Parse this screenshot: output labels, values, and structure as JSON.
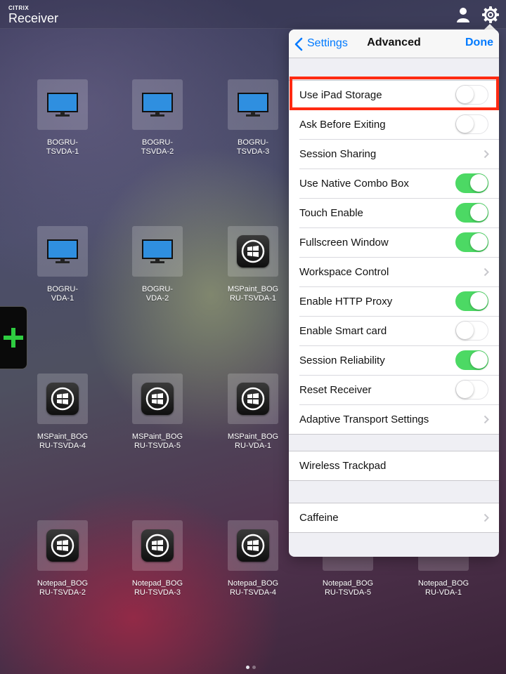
{
  "brand": {
    "small": "CITRIX",
    "large": "Receiver"
  },
  "topbar_icons": [
    "person-icon",
    "gear-icon"
  ],
  "tiles": [
    {
      "label": "BOGRU-\nTSVDA-1",
      "icon": "monitor"
    },
    {
      "label": "BOGRU-\nTSVDA-2",
      "icon": "monitor"
    },
    {
      "label": "BOGRU-\nTSVDA-3",
      "icon": "monitor"
    },
    {
      "label": "BOGRU-\nVDA-1",
      "icon": "monitor"
    },
    {
      "label": "BOGRU-\nVDA-2",
      "icon": "monitor"
    },
    {
      "label": "MSPaint_BOG\nRU-TSVDA-1",
      "icon": "windows"
    },
    {
      "label": "MSPaint_BOG\nRU-TSVDA-4",
      "icon": "windows"
    },
    {
      "label": "MSPaint_BOG\nRU-TSVDA-5",
      "icon": "windows"
    },
    {
      "label": "MSPaint_BOG\nRU-VDA-1",
      "icon": "windows"
    },
    {
      "label": "Notepad_BOG\nRU-TSVDA-2",
      "icon": "windows"
    },
    {
      "label": "Notepad_BOG\nRU-TSVDA-3",
      "icon": "windows"
    },
    {
      "label": "Notepad_BOG\nRU-TSVDA-4",
      "icon": "windows"
    },
    {
      "label": "Notepad_BOG\nRU-TSVDA-5",
      "icon": "hidden"
    },
    {
      "label": "Notepad_BOG\nRU-VDA-1",
      "icon": "hidden"
    }
  ],
  "popover": {
    "back_label": "Settings",
    "title": "Advanced",
    "done_label": "Done",
    "rows": [
      {
        "label": "Use iPad Storage",
        "control": "toggle",
        "on": false,
        "highlighted": true
      },
      {
        "label": "Ask Before Exiting",
        "control": "toggle",
        "on": false
      },
      {
        "label": "Session Sharing",
        "control": "chevron"
      },
      {
        "label": "Use Native Combo Box",
        "control": "toggle",
        "on": true
      },
      {
        "label": "Touch Enable",
        "control": "toggle",
        "on": true
      },
      {
        "label": "Fullscreen Window",
        "control": "toggle",
        "on": true
      },
      {
        "label": "Workspace Control",
        "control": "chevron"
      },
      {
        "label": "Enable HTTP Proxy",
        "control": "toggle",
        "on": true
      },
      {
        "label": "Enable Smart card",
        "control": "toggle",
        "on": false
      },
      {
        "label": "Session Reliability",
        "control": "toggle",
        "on": true
      },
      {
        "label": "Reset Receiver",
        "control": "toggle",
        "on": false
      },
      {
        "label": "Adaptive Transport Settings",
        "control": "chevron"
      }
    ],
    "wireless_label": "Wireless Trackpad",
    "caffeine_label": "Caffeine"
  },
  "page_dots": {
    "count": 2,
    "active": 0
  },
  "colors": {
    "accent": "#007aff",
    "toggle_on": "#4cd964",
    "highlight": "#ff2a12",
    "add_plus": "#2ecc40"
  }
}
